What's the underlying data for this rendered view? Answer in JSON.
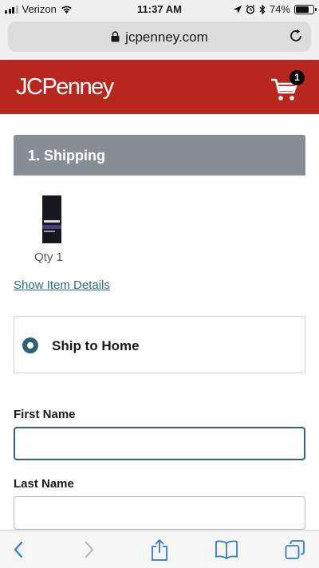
{
  "status_bar": {
    "carrier": "Verizon",
    "time": "11:37 AM",
    "battery_percent": "74%",
    "battery_level": 0.74,
    "icons": [
      "signal-icon",
      "wifi-icon",
      "location-icon",
      "alarm-icon",
      "bluetooth-icon",
      "battery-icon"
    ]
  },
  "browser": {
    "url": "jcpenney.com",
    "icons": [
      "lock-icon",
      "reload-icon"
    ]
  },
  "header": {
    "logo": "JCPenney",
    "cart_count": "1",
    "brand_color": "#b8271e"
  },
  "checkout": {
    "step_title": "1. Shipping",
    "item_qty": "Qty 1",
    "show_details_link": "Show Item Details",
    "ship_option": "Ship to Home",
    "first_name_label": "First Name",
    "first_name_value": "",
    "last_name_label": "Last Name",
    "last_name_value": "",
    "accent_color": "#2d6373"
  },
  "toolbar": {
    "icons": [
      "back-icon",
      "forward-icon",
      "share-icon",
      "bookmarks-icon",
      "tabs-icon"
    ]
  }
}
